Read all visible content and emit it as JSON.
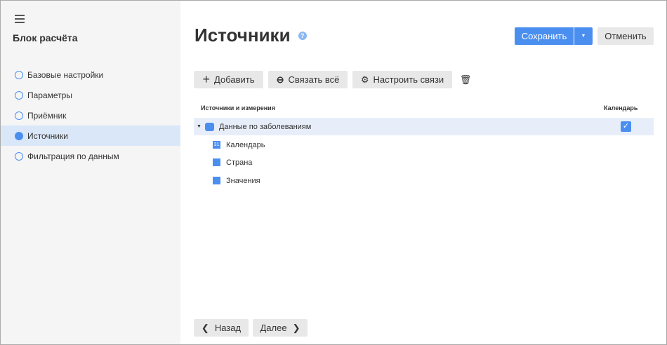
{
  "sidebar": {
    "title": "Блок расчёта",
    "items": [
      {
        "label": "Базовые настройки",
        "active": false
      },
      {
        "label": "Параметры",
        "active": false
      },
      {
        "label": "Приёмник",
        "active": false
      },
      {
        "label": "Источники",
        "active": true
      },
      {
        "label": "Фильтрация по данным",
        "active": false
      }
    ]
  },
  "header": {
    "title": "Источники",
    "help": "?",
    "save": "Сохранить",
    "cancel": "Отменить"
  },
  "toolbar": {
    "add": "Добавить",
    "link_all": "Связать всё",
    "configure": "Настроить связи"
  },
  "table": {
    "col_sources": "Источники и измерения",
    "col_calendar": "Календарь",
    "source": {
      "label": "Данные по заболеваниям",
      "calendar_checked": true
    },
    "dimensions": [
      {
        "label": "Календарь",
        "icon": "calendar-dimension-icon"
      },
      {
        "label": "Страна",
        "icon": "dimension-icon"
      },
      {
        "label": "Значения",
        "icon": "dimension-icon"
      }
    ]
  },
  "footer": {
    "back": "Назад",
    "next": "Далее"
  }
}
